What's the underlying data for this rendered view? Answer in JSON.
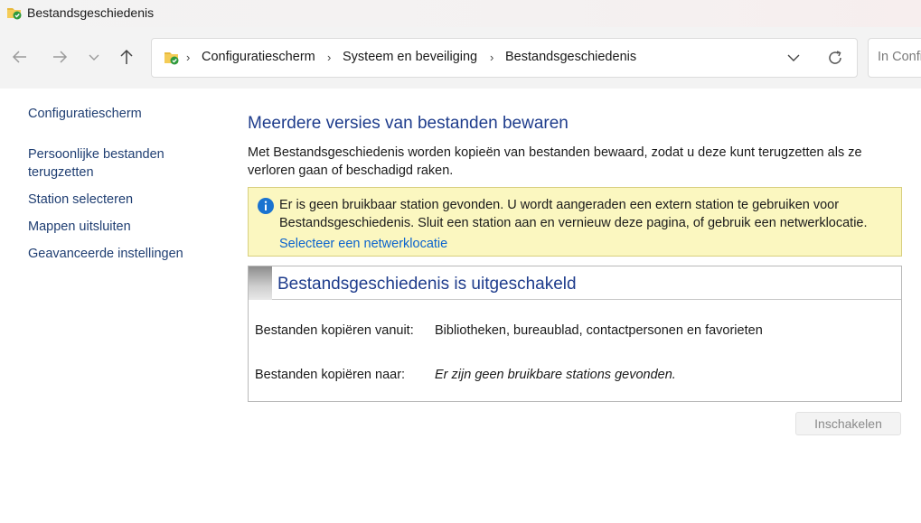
{
  "window": {
    "title": "Bestandsgeschiedenis",
    "icon": "file-history-folder-icon"
  },
  "nav": {
    "back_icon": "arrow-left-icon",
    "forward_icon": "arrow-right-icon",
    "recent_icon": "chevron-down-icon",
    "up_icon": "arrow-up-icon"
  },
  "address": {
    "breadcrumbs": [
      "Configuratiescherm",
      "Systeem en beveiliging",
      "Bestandsgeschiedenis"
    ],
    "separator": "›",
    "refresh_icon": "refresh-icon",
    "dropdown_icon": "chevron-down-icon"
  },
  "search": {
    "placeholder": "In Configuratiescherm zoeken"
  },
  "sidebar": {
    "items": [
      {
        "label": "Configuratiescherm"
      },
      {
        "label": "Persoonlijke bestanden terugzetten"
      },
      {
        "label": "Station selecteren"
      },
      {
        "label": "Mappen uitsluiten"
      },
      {
        "label": "Geavanceerde instellingen"
      }
    ]
  },
  "main": {
    "heading": "Meerdere versies van bestanden bewaren",
    "description": "Met Bestandsgeschiedenis worden kopieën van bestanden bewaard, zodat u deze kunt terugzetten als ze verloren gaan of beschadigd raken.",
    "info": {
      "icon": "info-icon",
      "text": "Er is geen bruikbaar station gevonden. U wordt aangeraden een extern station te gebruiken voor Bestandsgeschiedenis. Sluit een station aan en vernieuw deze pagina, of gebruik een netwerklocatie.",
      "link": "Selecteer een netwerklocatie"
    },
    "status": {
      "title": "Bestandsgeschiedenis is uitgeschakeld",
      "copy_from_label": "Bestanden kopiëren vanuit:",
      "copy_from_value": "Bibliotheken, bureaublad, contactpersonen en favorieten",
      "copy_to_label": "Bestanden kopiëren naar:",
      "copy_to_value": "Er zijn geen bruikbare stations gevonden."
    },
    "enable_button": "Inschakelen"
  },
  "colors": {
    "link_blue": "#0b63ce",
    "heading_blue": "#1e3c8c",
    "sidebar_blue": "#1f3e72",
    "info_background": "#fbf7c0",
    "info_border": "#d8cf7f"
  }
}
